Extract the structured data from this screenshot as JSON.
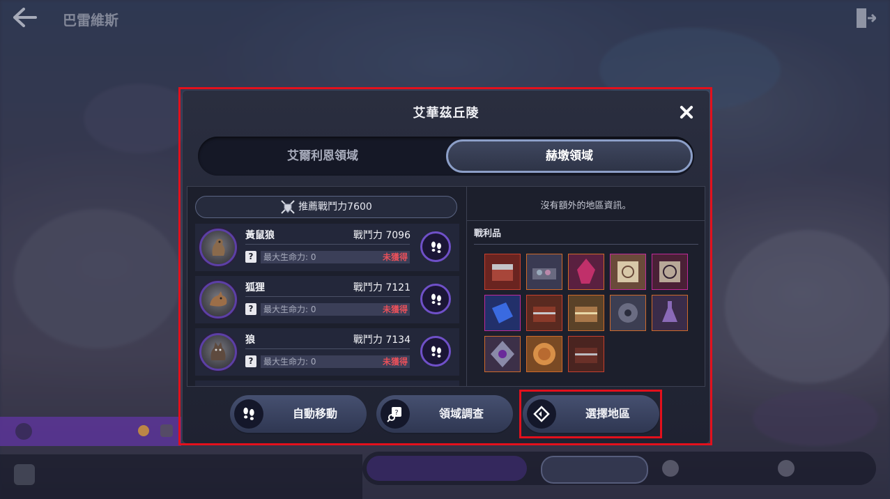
{
  "background": {
    "back_icon": "back-arrow-icon",
    "title": "巴雷維斯",
    "exit_icon": "exit-door-icon"
  },
  "modal": {
    "title": "艾華茲丘陵",
    "close_icon": "close-icon",
    "tabs": [
      {
        "label": "艾爾利恩領域",
        "selected": false
      },
      {
        "label": "赫墩領域",
        "selected": true
      }
    ],
    "recommended_power": "推薦戰鬥力7600",
    "monsters": [
      {
        "name": "黃鼠狼",
        "power": "戰鬥力 7096",
        "hp": "最大生命力: 0",
        "status": "未獲得",
        "icon": "weasel-icon"
      },
      {
        "name": "狐狸",
        "power": "戰鬥力 7121",
        "hp": "最大生命力: 0",
        "status": "未獲得",
        "icon": "fox-icon"
      },
      {
        "name": "狼",
        "power": "戰鬥力 7134",
        "hp": "最大生命力: 0",
        "status": "未獲得",
        "icon": "wolf-icon"
      }
    ],
    "info_text": "沒有額外的地區資訊。",
    "loot_title": "戰利品",
    "loot_items": [
      {
        "icon": "red-chest-icon",
        "rarity_color": "#c8402e"
      },
      {
        "icon": "gem-box-icon",
        "rarity_color": "#d06a2a"
      },
      {
        "icon": "red-crystal-icon",
        "rarity_color": "#d06a2a"
      },
      {
        "icon": "scroll-icon",
        "rarity_color": "#c02a9a"
      },
      {
        "icon": "magic-scroll-icon",
        "rarity_color": "#c02a9a"
      },
      {
        "icon": "blue-crystal-icon",
        "rarity_color": "#c02a9a"
      },
      {
        "icon": "chest-icon",
        "rarity_color": "#c8402e"
      },
      {
        "icon": "gold-chest-icon",
        "rarity_color": "#d06a2a"
      },
      {
        "icon": "wheel-icon",
        "rarity_color": "#d06a2a"
      },
      {
        "icon": "potion-icon",
        "rarity_color": "#d06a2a"
      },
      {
        "icon": "emblem-icon",
        "rarity_color": "#d06a2a"
      },
      {
        "icon": "gold-coin-icon",
        "rarity_color": "#d06a2a"
      },
      {
        "icon": "dark-chest-icon",
        "rarity_color": "#c8402e"
      }
    ],
    "buttons": [
      {
        "label": "自動移動",
        "icon": "footsteps-icon"
      },
      {
        "label": "領域調查",
        "icon": "investigate-icon"
      },
      {
        "label": "選擇地區",
        "icon": "region-select-icon"
      }
    ]
  },
  "colors": {
    "accent_purple": "#6f50c8",
    "status_red": "#e8505a",
    "highlight_red": "#e3101c",
    "tab_selected_border": "#8c9fc8"
  }
}
